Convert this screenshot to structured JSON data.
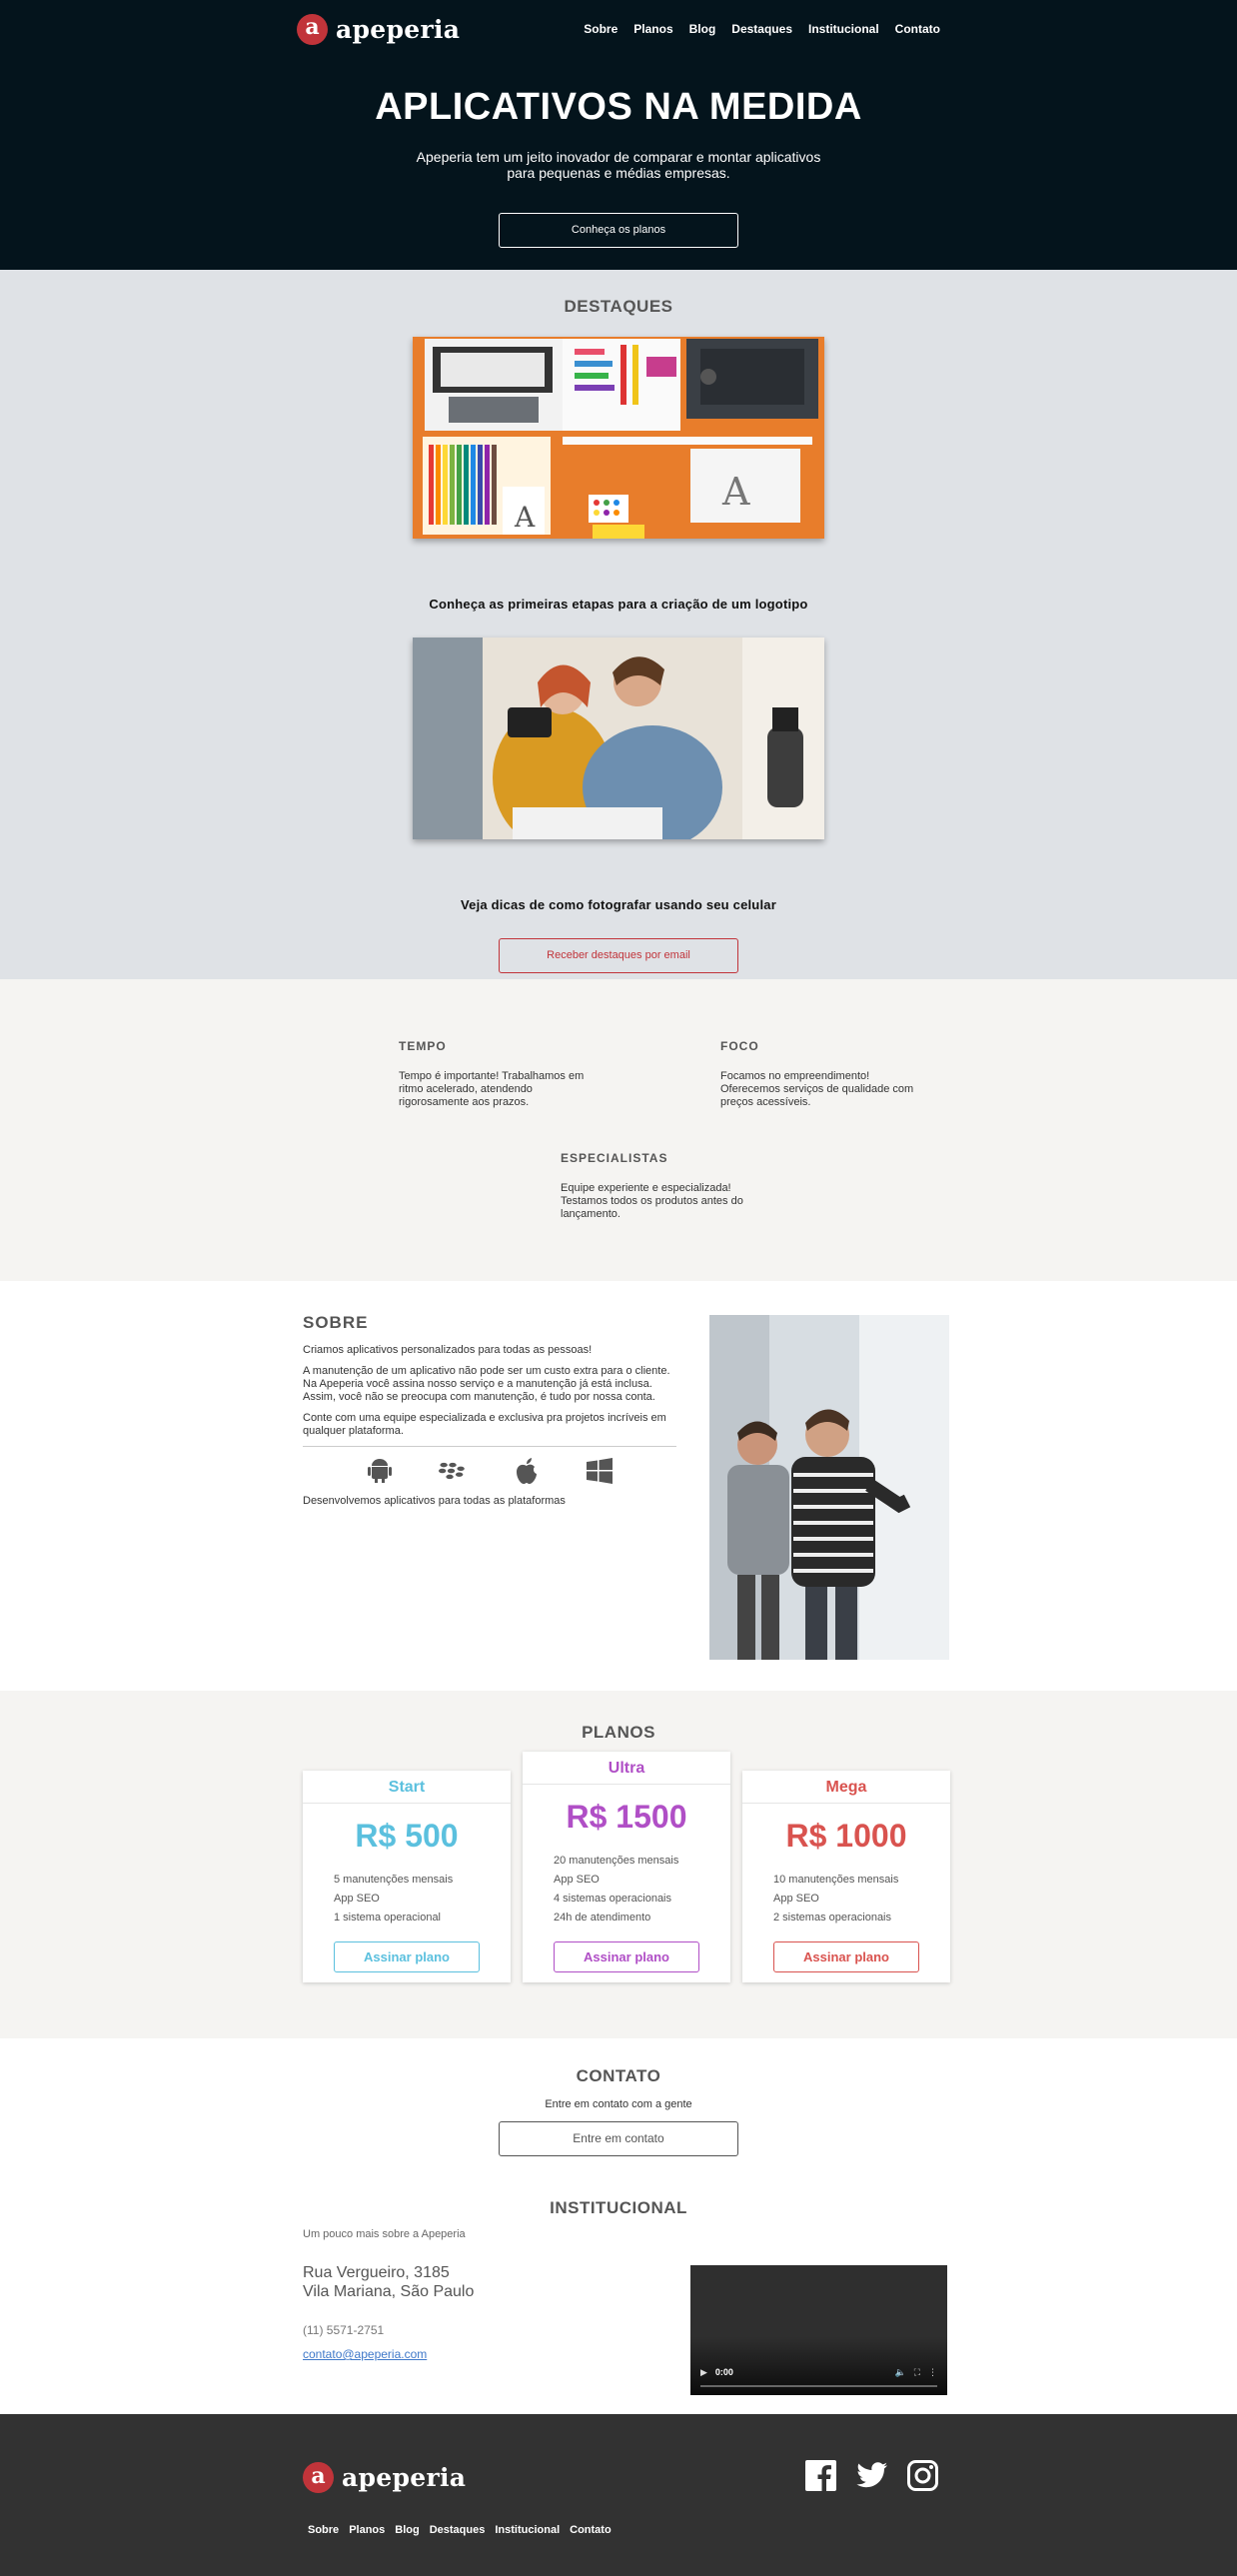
{
  "header": {
    "logo_mark": "a",
    "logo_text": "apeperia",
    "nav": [
      "Sobre",
      "Planos",
      "Blog",
      "Destaques",
      "Institucional",
      "Contato"
    ],
    "title": "APLICATIVOS NA MEDIDA",
    "subtitle": "Apeperia tem um jeito inovador de comparar e montar aplicativos para pequenas e médias empresas.",
    "cta": "Conheça os planos"
  },
  "destaques": {
    "title": "DESTAQUES",
    "items": [
      {
        "caption": "Conheça as primeiras etapas para a criação de um logotipo"
      },
      {
        "caption": "Veja dicas de como fotografar usando seu celular"
      }
    ],
    "cta": "Receber destaques por email"
  },
  "features": [
    {
      "title": "TEMPO",
      "text": "Tempo é importante! Trabalhamos em ritmo acelerado, atendendo rigorosamente aos prazos."
    },
    {
      "title": "FOCO",
      "text": "Focamos no empreendimento! Oferecemos serviços de qualidade com preços acessíveis."
    },
    {
      "title": "ESPECIALISTAS",
      "text": "Equipe experiente e especializada! Testamos todos os produtos antes do lançamento."
    }
  ],
  "sobre": {
    "title": "SOBRE",
    "p1": "Criamos aplicativos personalizados para todas as pessoas!",
    "p2": "A manutenção de um aplicativo não pode ser um custo extra para o cliente. Na Apeperia você assina nosso serviço e a manutenção já está inclusa. Assim, você não se preocupa com manutenção, é tudo por nossa conta.",
    "p3": "Conte com uma equipe especializada e exclusiva pra projetos incríveis em qualquer plataforma.",
    "platforms": [
      "android-icon",
      "blackberry-icon",
      "apple-icon",
      "windows-icon"
    ],
    "platforms_caption": "Desenvolvemos aplicativos para todas as plataformas"
  },
  "planos": {
    "title": "PLANOS",
    "plans": [
      {
        "name": "Start",
        "price": "R$ 500",
        "color": "#5bc0de",
        "features": [
          "5 manutenções mensais",
          "App SEO",
          "1 sistema operacional"
        ],
        "cta": "Assinar plano"
      },
      {
        "name": "Ultra",
        "price": "R$ 1500",
        "color": "#b04fc6",
        "features": [
          "20 manutenções mensais",
          "App SEO",
          "4 sistemas operacionais",
          "24h de atendimento"
        ],
        "cta": "Assinar plano"
      },
      {
        "name": "Mega",
        "price": "R$ 1000",
        "color": "#d9534f",
        "features": [
          "10 manutenções mensais",
          "App SEO",
          "2 sistemas operacionais"
        ],
        "cta": "Assinar plano"
      }
    ]
  },
  "contato": {
    "title": "CONTATO",
    "lead": "Entre em contato com a gente",
    "cta": "Entre em contato"
  },
  "institucional": {
    "title": "INSTITUCIONAL",
    "sub": "Um pouco mais sobre a Apeperia",
    "address1": "Rua Vergueiro, 3185",
    "address2": "Vila Mariana, São Paulo",
    "phone": "(11) 5571-2751",
    "email": "contato@apeperia.com",
    "video_time": "0:00"
  },
  "footer": {
    "logo_mark": "a",
    "logo_text": "apeperia",
    "social": [
      "facebook-icon",
      "twitter-icon",
      "instagram-icon"
    ],
    "nav": [
      "Sobre",
      "Planos",
      "Blog",
      "Destaques",
      "Institucional",
      "Contato"
    ]
  }
}
